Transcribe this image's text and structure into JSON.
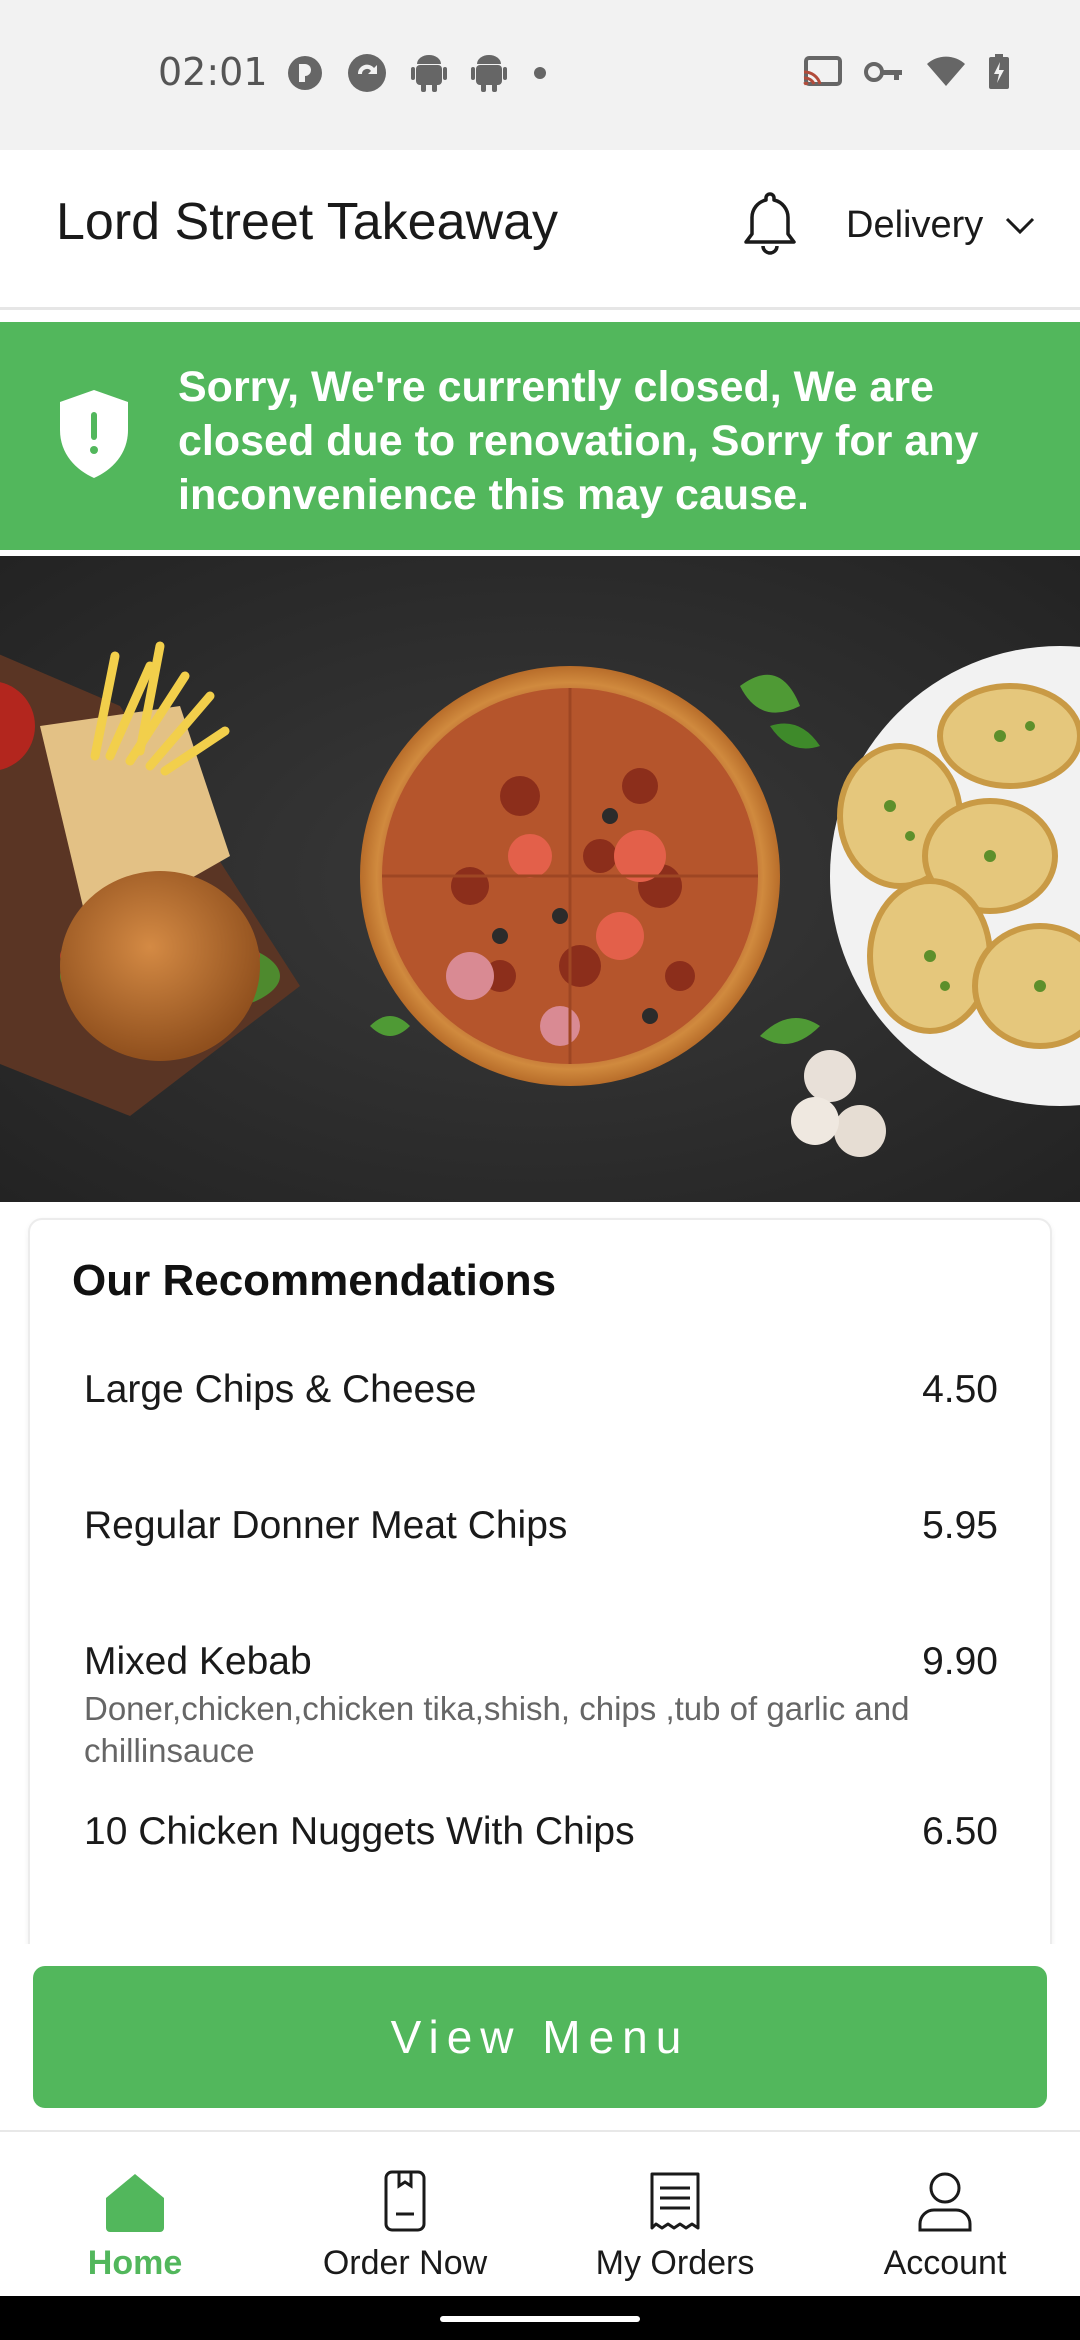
{
  "status_bar": {
    "time": "02:01"
  },
  "header": {
    "title": "Lord Street Takeaway",
    "mode_label": "Delivery"
  },
  "banner": {
    "message": "Sorry, We're currently closed, We are closed due to renovation, Sorry for any inconvenience this may cause."
  },
  "recommendations": {
    "title": "Our Recommendations",
    "items": [
      {
        "name": "Large Chips & Cheese",
        "price": "4.50",
        "description": ""
      },
      {
        "name": "Regular Donner Meat Chips",
        "price": "5.95",
        "description": ""
      },
      {
        "name": "Mixed Kebab",
        "price": "9.90",
        "description": "Doner,chicken,chicken tika,shish, chips ,tub of garlic and chillinsauce"
      },
      {
        "name": "10 Chicken Nuggets With Chips",
        "price": "6.50",
        "description": ""
      }
    ]
  },
  "view_menu_label": "View Menu",
  "bottom_nav": {
    "items": [
      {
        "label": "Home",
        "icon": "home-icon",
        "active": true
      },
      {
        "label": "Order Now",
        "icon": "order-icon",
        "active": false
      },
      {
        "label": "My Orders",
        "icon": "receipt-icon",
        "active": false
      },
      {
        "label": "Account",
        "icon": "account-icon",
        "active": false
      }
    ]
  },
  "colors": {
    "accent": "#52b75c",
    "text": "#1a1a1a",
    "muted": "#666666"
  }
}
